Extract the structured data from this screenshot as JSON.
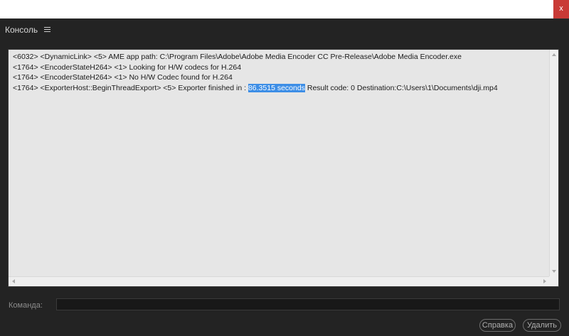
{
  "window": {
    "close_label": "x"
  },
  "panel": {
    "title": "Консоль"
  },
  "console": {
    "lines": [
      {
        "text": "<6032> <DynamicLink> <5>  AME app path:  C:\\Program Files\\Adobe\\Adobe Media Encoder CC Pre-Release\\Adobe Media Encoder.exe"
      },
      {
        "text": "<1764> <EncoderStateH264> <1> Looking for H/W codecs for H.264"
      },
      {
        "text": "<1764> <EncoderStateH264> <1> No H/W Codec found for H.264"
      },
      {
        "before": "<1764> <ExporterHost::BeginThreadExport> <5> Exporter finished in : ",
        "selected": "86.3515 seconds",
        "after": " Result code: 0 Destination:C:\\Users\\1\\Documents\\dji.mp4"
      }
    ]
  },
  "command": {
    "label": "Команда:",
    "value": ""
  },
  "buttons": {
    "help": "Справка",
    "delete": "Удалить"
  },
  "colors": {
    "selection": "#3d8ee6",
    "close": "#c93a36",
    "background": "#232323"
  }
}
